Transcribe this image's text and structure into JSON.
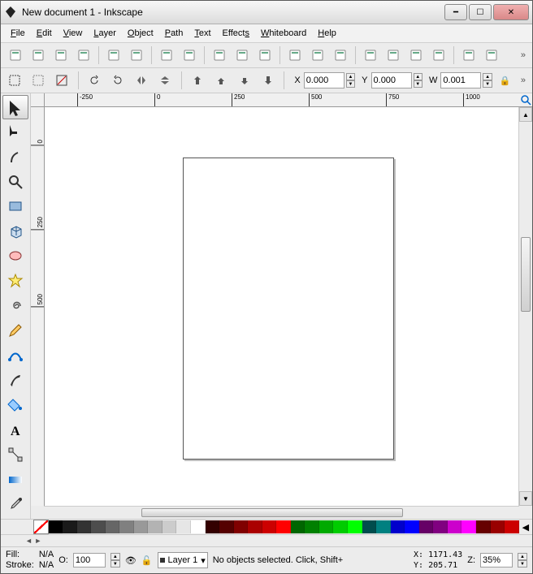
{
  "window": {
    "title": "New document 1 - Inkscape"
  },
  "menu": [
    {
      "label": "File",
      "u": "F"
    },
    {
      "label": "Edit",
      "u": "E"
    },
    {
      "label": "View",
      "u": "V"
    },
    {
      "label": "Layer",
      "u": "L"
    },
    {
      "label": "Object",
      "u": "O"
    },
    {
      "label": "Path",
      "u": "P"
    },
    {
      "label": "Text",
      "u": "T"
    },
    {
      "label": "Effects",
      "u": "s"
    },
    {
      "label": "Whiteboard",
      "u": "W"
    },
    {
      "label": "Help",
      "u": "H"
    }
  ],
  "toolbar1": {
    "icons": [
      "new-file-icon",
      "open-file-icon",
      "save-icon",
      "print-icon",
      "import-icon",
      "export-icon",
      "undo-icon",
      "redo-icon",
      "copy-icon",
      "cut-icon",
      "paste-icon",
      "zoom-fit-icon",
      "zoom-page-icon",
      "zoom-drawing-icon",
      "duplicate-icon",
      "clone-icon",
      "unlink-clone-icon",
      "select-original-icon",
      "xml-editor-icon",
      "align-icon"
    ]
  },
  "tool_controls": {
    "x_label": "X",
    "x_value": "0.000",
    "y_label": "Y",
    "y_value": "0.000",
    "w_label": "W",
    "w_value": "0.001",
    "suffix_icons": [
      "lock-icon"
    ]
  },
  "toolbox": [
    {
      "name": "select-tool",
      "active": true
    },
    {
      "name": "node-tool"
    },
    {
      "name": "tweak-tool"
    },
    {
      "name": "zoom-tool"
    },
    {
      "name": "rect-tool"
    },
    {
      "name": "3dbox-tool"
    },
    {
      "name": "ellipse-tool"
    },
    {
      "name": "star-tool"
    },
    {
      "name": "spiral-tool"
    },
    {
      "name": "pencil-tool"
    },
    {
      "name": "bezier-tool"
    },
    {
      "name": "calligraphy-tool"
    },
    {
      "name": "paint-bucket-tool"
    },
    {
      "name": "text-tool"
    },
    {
      "name": "connector-tool"
    },
    {
      "name": "gradient-tool"
    },
    {
      "name": "dropper-tool"
    }
  ],
  "ruler_h": [
    "-250",
    "0",
    "250",
    "500",
    "750",
    "1000"
  ],
  "ruler_v": [
    "0",
    "250",
    "500"
  ],
  "palette_colors": [
    "#000000",
    "#1a1a1a",
    "#333333",
    "#4d4d4d",
    "#666666",
    "#808080",
    "#999999",
    "#b3b3b3",
    "#cccccc",
    "#e6e6e6",
    "#ffffff",
    "#330000",
    "#550000",
    "#800000",
    "#aa0000",
    "#cc0000",
    "#ff0000",
    "#006600",
    "#008000",
    "#00aa00",
    "#00cc00",
    "#00ff00",
    "#004d4d",
    "#008080",
    "#0000cc",
    "#0000ff",
    "#660066",
    "#800080",
    "#cc00cc",
    "#ff00ff",
    "#660000",
    "#990000",
    "#cc0000"
  ],
  "status": {
    "fill_label": "Fill:",
    "fill_value": "N/A",
    "stroke_label": "Stroke:",
    "stroke_value": "N/A",
    "opacity_label": "O:",
    "opacity_value": "100",
    "layer_name": "Layer 1",
    "message": "No objects selected. Click, Shift+",
    "x_label": "X:",
    "x_value": "1171.43",
    "y_label": "Y:",
    "y_value": "205.71",
    "z_label": "Z:",
    "z_value": "35%"
  }
}
